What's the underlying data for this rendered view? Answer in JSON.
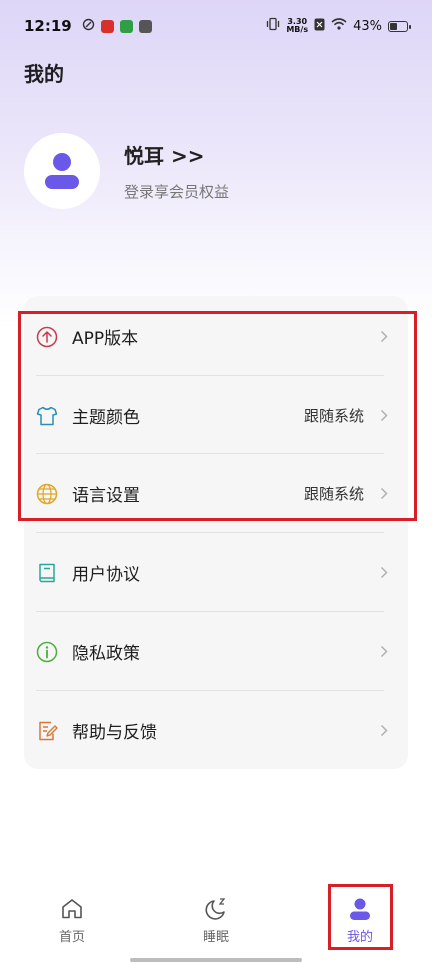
{
  "status_bar": {
    "time": "12:19",
    "net_speed_value": "3.30",
    "net_speed_unit": "MB/s",
    "battery": "43%"
  },
  "page": {
    "title": "我的"
  },
  "profile": {
    "name": "悦耳 >>",
    "subtitle": "登录享会员权益"
  },
  "menu": {
    "items": [
      {
        "label": "APP版本",
        "value": ""
      },
      {
        "label": "主题颜色",
        "value": "跟随系统"
      },
      {
        "label": "语言设置",
        "value": "跟随系统"
      },
      {
        "label": "用户协议",
        "value": ""
      },
      {
        "label": "隐私政策",
        "value": ""
      },
      {
        "label": "帮助与反馈",
        "value": ""
      }
    ]
  },
  "tabs": [
    {
      "label": "首页",
      "active": false
    },
    {
      "label": "睡眠",
      "active": false
    },
    {
      "label": "我的",
      "active": true
    }
  ],
  "colors": {
    "accent": "#6a58e8",
    "highlight_border": "#d61f26"
  },
  "icons": {
    "app_version": "arrow-up-circle-icon",
    "theme": "shirt-icon",
    "language": "globe-icon",
    "agreement": "book-icon",
    "privacy": "info-circle-icon",
    "help": "edit-document-icon",
    "tab_home": "home-icon",
    "tab_sleep": "moon-icon",
    "tab_mine": "user-icon"
  }
}
